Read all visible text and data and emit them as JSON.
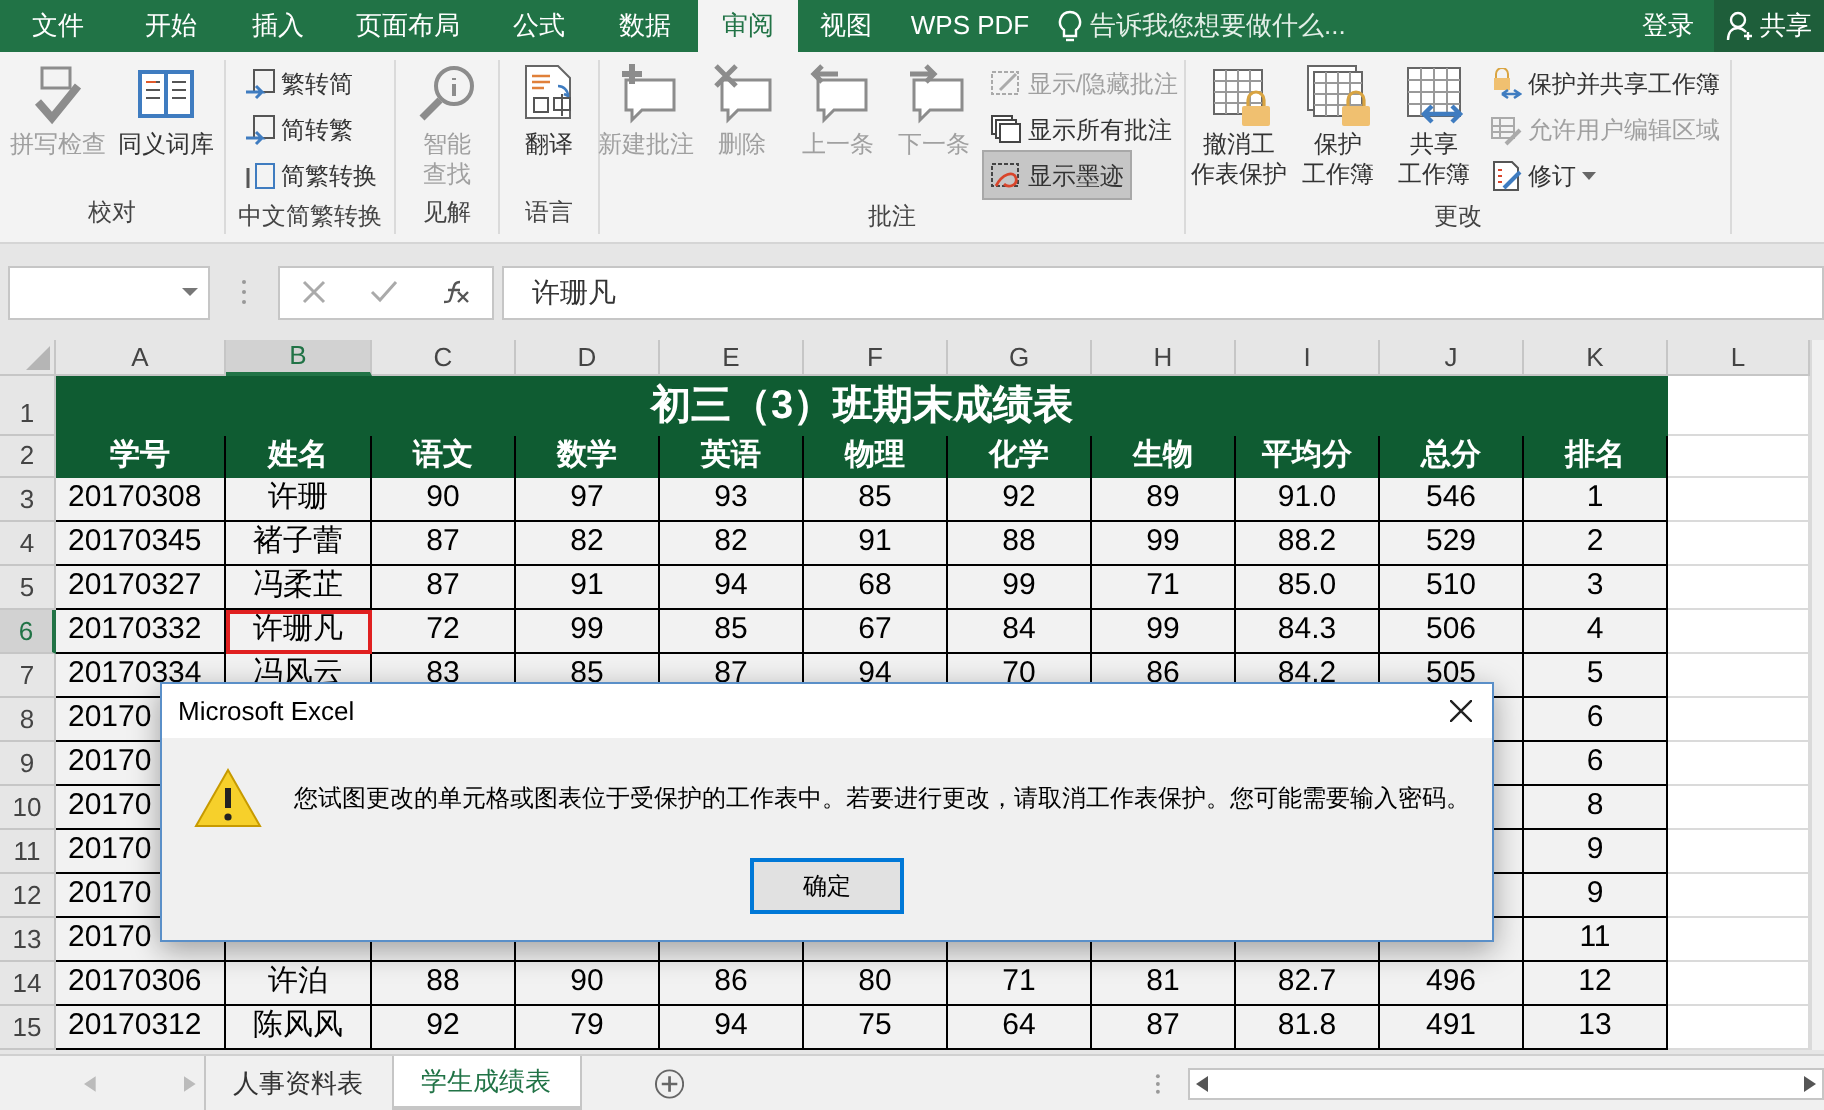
{
  "ribbon_tabs": [
    {
      "label": "文件",
      "selected": false
    },
    {
      "label": "开始",
      "selected": false
    },
    {
      "label": "插入",
      "selected": false
    },
    {
      "label": "页面布局",
      "selected": false
    },
    {
      "label": "公式",
      "selected": false
    },
    {
      "label": "数据",
      "selected": false
    },
    {
      "label": "审阅",
      "selected": true
    },
    {
      "label": "视图",
      "selected": false
    },
    {
      "label": "WPS PDF",
      "selected": false
    }
  ],
  "tell_me": {
    "placeholder": "告诉我您想要做什么..."
  },
  "sign_in": "登录",
  "share": "共享",
  "ribbon_groups": [
    {
      "label": "校对",
      "commands": [
        {
          "kind": "large",
          "label": "拼写检查",
          "disabled": true
        },
        {
          "kind": "large",
          "label": "同义词库",
          "disabled": false
        }
      ]
    },
    {
      "label": "中文简繁转换",
      "commands": [
        {
          "kind": "small",
          "label": "繁转简",
          "disabled": false
        },
        {
          "kind": "small",
          "label": "简转繁",
          "disabled": false
        },
        {
          "kind": "small",
          "label": "简繁转换",
          "disabled": false
        }
      ]
    },
    {
      "label": "见解",
      "commands": [
        {
          "kind": "large",
          "label": "智能查找",
          "disabled": true
        }
      ]
    },
    {
      "label": "语言",
      "commands": [
        {
          "kind": "large",
          "label": "翻译",
          "disabled": false
        }
      ]
    },
    {
      "label": "批注",
      "commands": [
        {
          "kind": "large",
          "label": "新建批注",
          "disabled": true,
          "on": false
        },
        {
          "kind": "large",
          "label": "删除",
          "disabled": true,
          "on": false
        },
        {
          "kind": "large",
          "label": "上一条",
          "disabled": true,
          "on": false
        },
        {
          "kind": "large",
          "label": "下一条",
          "disabled": true,
          "on": false
        },
        {
          "kind": "small",
          "label": "显示/隐藏批注",
          "disabled": true,
          "on": false
        },
        {
          "kind": "small",
          "label": "显示所有批注",
          "disabled": false,
          "on": false
        },
        {
          "kind": "small",
          "label": "显示墨迹",
          "disabled": false,
          "on": true
        }
      ]
    },
    {
      "label": "更改",
      "commands": [
        {
          "kind": "large",
          "label": "撤消工作表保护",
          "disabled": false
        },
        {
          "kind": "large",
          "label": "保护工作簿",
          "disabled": false
        },
        {
          "kind": "large",
          "label": "共享工作簿",
          "disabled": false
        },
        {
          "kind": "small",
          "label": "保护并共享工作簿",
          "disabled": false
        },
        {
          "kind": "small",
          "label": "允许用户编辑区域",
          "disabled": true
        },
        {
          "kind": "small-dropdown",
          "label": "修订",
          "disabled": false
        }
      ]
    }
  ],
  "formula_bar": {
    "value": "许珊凡"
  },
  "columns": [
    {
      "label": "A",
      "selected": false
    },
    {
      "label": "B",
      "selected": true
    },
    {
      "label": "C",
      "selected": false
    },
    {
      "label": "D",
      "selected": false
    },
    {
      "label": "E",
      "selected": false
    },
    {
      "label": "F",
      "selected": false
    },
    {
      "label": "G",
      "selected": false
    },
    {
      "label": "H",
      "selected": false
    },
    {
      "label": "I",
      "selected": false
    },
    {
      "label": "J",
      "selected": false
    },
    {
      "label": "K",
      "selected": false
    },
    {
      "label": "L",
      "selected": false
    }
  ],
  "row_numbers": [
    {
      "label": "1",
      "selected": false
    },
    {
      "label": "2",
      "selected": false
    },
    {
      "label": "3",
      "selected": false
    },
    {
      "label": "4",
      "selected": false
    },
    {
      "label": "5",
      "selected": false
    },
    {
      "label": "6",
      "selected": true
    },
    {
      "label": "7",
      "selected": false
    },
    {
      "label": "8",
      "selected": false
    },
    {
      "label": "9",
      "selected": false
    },
    {
      "label": "10",
      "selected": false
    },
    {
      "label": "11",
      "selected": false
    },
    {
      "label": "12",
      "selected": false
    },
    {
      "label": "13",
      "selected": false
    },
    {
      "label": "14",
      "selected": false
    },
    {
      "label": "15",
      "selected": false
    }
  ],
  "sheet": {
    "title": "初三（3）班期末成绩表",
    "headers": [
      "学号",
      "姓名",
      "语文",
      "数学",
      "英语",
      "物理",
      "化学",
      "生物",
      "平均分",
      "总分",
      "排名"
    ],
    "rows": [
      {
        "cells": [
          "20170308",
          "许珊",
          "90",
          "97",
          "93",
          "85",
          "92",
          "89",
          "91.0",
          "546",
          "1"
        ]
      },
      {
        "cells": [
          "20170345",
          "褚子蕾",
          "87",
          "82",
          "82",
          "91",
          "88",
          "99",
          "88.2",
          "529",
          "2"
        ]
      },
      {
        "cells": [
          "20170327",
          "冯柔芷",
          "87",
          "91",
          "94",
          "68",
          "99",
          "71",
          "85.0",
          "510",
          "3"
        ]
      },
      {
        "cells": [
          "20170332",
          "许珊凡",
          "72",
          "99",
          "85",
          "67",
          "84",
          "99",
          "84.3",
          "506",
          "4"
        ]
      },
      {
        "cells": [
          "20170334",
          "冯风云",
          "83",
          "85",
          "87",
          "94",
          "70",
          "86",
          "84.2",
          "505",
          "5"
        ]
      },
      {
        "first": "20170",
        "last": "6"
      },
      {
        "first": "20170",
        "last": "6"
      },
      {
        "first": "20170",
        "last": "8"
      },
      {
        "first": "20170",
        "last": "9"
      },
      {
        "first": "20170",
        "last": "9"
      },
      {
        "first": "20170",
        "last": "11"
      },
      {
        "cells": [
          "20170306",
          "许泊",
          "88",
          "90",
          "86",
          "80",
          "71",
          "81",
          "82.7",
          "496",
          "12"
        ]
      },
      {
        "cells": [
          "20170312",
          "陈风风",
          "92",
          "79",
          "94",
          "75",
          "64",
          "87",
          "81.8",
          "491",
          "13"
        ]
      }
    ]
  },
  "dialog": {
    "title": "Microsoft Excel",
    "message": "您试图更改的单元格或图表位于受保护的工作表中。若要进行更改，请取消工作表保护。您可能需要输入密码。",
    "button": "确定"
  },
  "sheet_tabs": [
    {
      "label": "人事资料表",
      "selected": false
    },
    {
      "label": "学生成绩表",
      "selected": true
    }
  ]
}
